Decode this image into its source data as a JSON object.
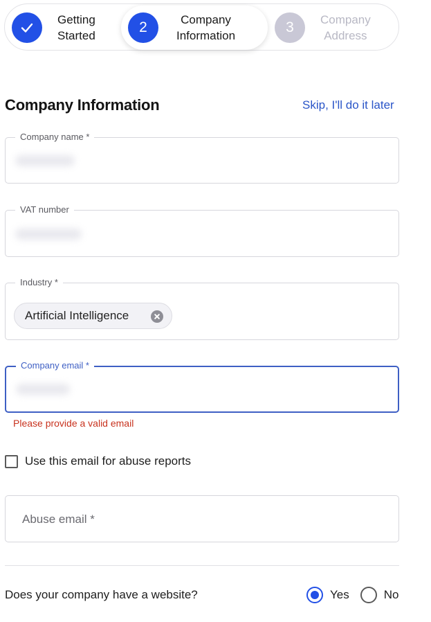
{
  "stepper": {
    "steps": [
      {
        "number": "✓",
        "line1": "Getting",
        "line2": "Started",
        "state": "completed"
      },
      {
        "number": "2",
        "line1": "Company",
        "line2": "Information",
        "state": "active"
      },
      {
        "number": "3",
        "line1": "Company",
        "line2": "Address",
        "state": "upcoming"
      }
    ]
  },
  "heading": "Company Information",
  "skip_link": "Skip, I'll do it later",
  "fields": {
    "company_name": {
      "label": "Company name *"
    },
    "vat_number": {
      "label": "VAT number"
    },
    "industry": {
      "label": "Industry *",
      "chips": [
        "Artificial Intelligence"
      ]
    },
    "company_email": {
      "label": "Company email *",
      "error": "Please provide a valid email"
    },
    "abuse_email": {
      "placeholder": "Abuse email *"
    }
  },
  "checkbox": {
    "label": "Use this email for abuse reports",
    "checked": false
  },
  "website_question": {
    "text": "Does your company have a website?",
    "options": [
      {
        "label": "Yes",
        "selected": true
      },
      {
        "label": "No",
        "selected": false
      }
    ]
  },
  "colors": {
    "primary": "#2250e6",
    "link": "#2a55c8",
    "error": "#c8321e",
    "focus_border": "#3e5fc4",
    "inactive_step": "#c9c8d6"
  }
}
